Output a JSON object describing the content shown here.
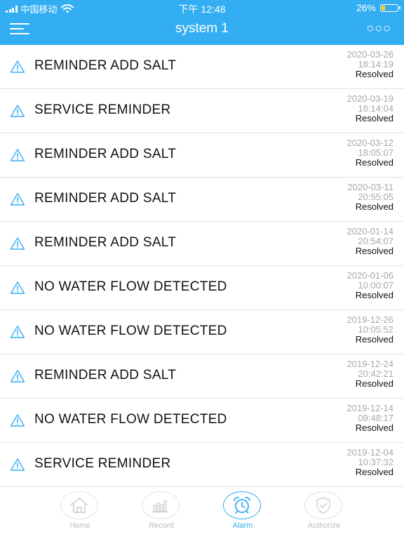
{
  "status_bar": {
    "carrier": "中国移动",
    "time": "下午 12:48",
    "battery_percent": "26%",
    "battery_level": 0.26,
    "icons": [
      "signal-icon",
      "wifi-icon",
      "battery-icon"
    ]
  },
  "nav": {
    "title": "system 1",
    "menu_icon": "menu-icon",
    "more_label": "○○○"
  },
  "alarms": [
    {
      "message": "REMINDER ADD SALT",
      "date": "2020-03-26",
      "time": "18:14:19",
      "status": "Resolved"
    },
    {
      "message": "SERVICE REMINDER",
      "date": "2020-03-19",
      "time": "18:14:04",
      "status": "Resolved"
    },
    {
      "message": "REMINDER ADD SALT",
      "date": "2020-03-12",
      "time": "18:05:07",
      "status": "Resolved"
    },
    {
      "message": "REMINDER ADD SALT",
      "date": "2020-03-11",
      "time": "20:55:05",
      "status": "Resolved"
    },
    {
      "message": "REMINDER ADD SALT",
      "date": "2020-01-14",
      "time": "20:54:07",
      "status": "Resolved"
    },
    {
      "message": "NO WATER FLOW DETECTED",
      "date": "2020-01-06",
      "time": "10:00:07",
      "status": "Resolved"
    },
    {
      "message": "NO WATER FLOW DETECTED",
      "date": "2019-12-26",
      "time": "10:05:52",
      "status": "Resolved"
    },
    {
      "message": "REMINDER ADD SALT",
      "date": "2019-12-24",
      "time": "20:42:21",
      "status": "Resolved"
    },
    {
      "message": "NO WATER FLOW DETECTED",
      "date": "2019-12-14",
      "time": "09:48:17",
      "status": "Resolved"
    },
    {
      "message": "SERVICE REMINDER",
      "date": "2019-12-04",
      "time": "10:37:32",
      "status": "Resolved"
    }
  ],
  "tabs": [
    {
      "label": "Home",
      "icon": "home-icon",
      "active": false
    },
    {
      "label": "Record",
      "icon": "bar-chart-icon",
      "active": false
    },
    {
      "label": "Alarm",
      "icon": "alarm-clock-icon",
      "active": true
    },
    {
      "label": "Authorize",
      "icon": "shield-check-icon",
      "active": false
    }
  ],
  "colors": {
    "accent": "#33aef3",
    "inactive": "#bdbdbd",
    "divider": "#e2e2e2",
    "battery": "#ffd21f"
  }
}
